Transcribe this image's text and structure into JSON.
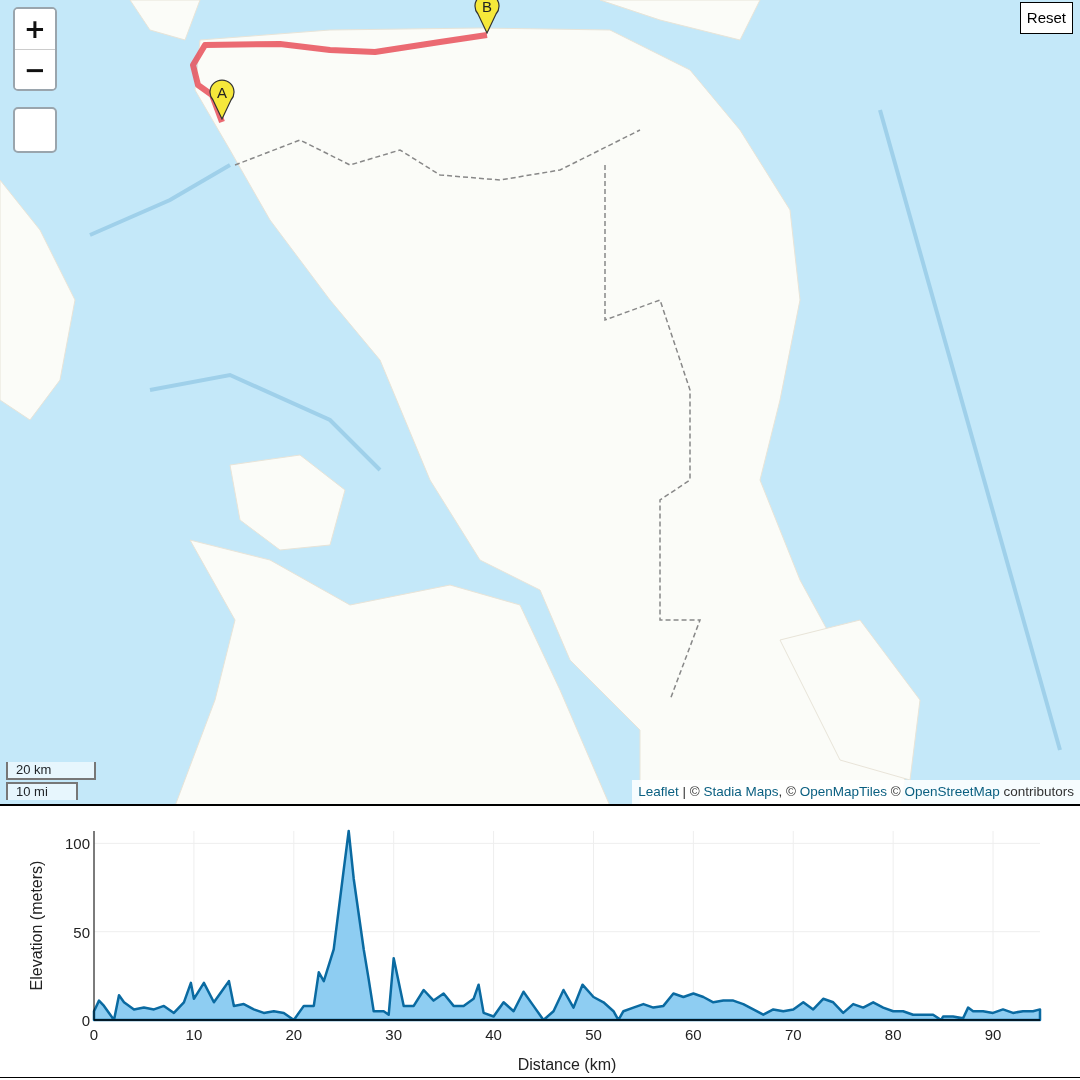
{
  "map": {
    "zoom_buttons": [
      "+",
      "−"
    ],
    "reset_button": "Reset",
    "markers": [
      {
        "label": "A"
      },
      {
        "label": "B"
      }
    ],
    "scale": [
      "20 km",
      "10 mi"
    ],
    "attribution": [
      {
        "text": "Leaflet",
        "link": true
      },
      {
        "text": " | © ",
        "link": false
      },
      {
        "text": "Stadia Maps",
        "link": true
      },
      {
        "text": ", © ",
        "link": false
      },
      {
        "text": "OpenMapTiles",
        "link": true
      },
      {
        "text": " © ",
        "link": false
      },
      {
        "text": "OpenStreetMap",
        "link": true
      },
      {
        "text": " contributors",
        "link": false
      }
    ]
  },
  "elevation_chart": {
    "chart_data": {
      "type": "area",
      "xlabel": "Distance (km)",
      "ylabel": "Elevation (meters)",
      "x": [
        0,
        0.5,
        1,
        1.5,
        2,
        2.5,
        3,
        4,
        5,
        6,
        7,
        8,
        9,
        9.7,
        10,
        11,
        12,
        13,
        13.5,
        14,
        15,
        16,
        17,
        18,
        19,
        20,
        21,
        22,
        22.5,
        23,
        24,
        25,
        25.5,
        26,
        27,
        27.5,
        28,
        29,
        29.5,
        30,
        31,
        32,
        33,
        34,
        35,
        36,
        37,
        38,
        38.5,
        39,
        40,
        41,
        42,
        43,
        44,
        45,
        46,
        47,
        48,
        48.9,
        50,
        51,
        52,
        52.5,
        53,
        54,
        55,
        56,
        57,
        58,
        59,
        60,
        61,
        62,
        63,
        64,
        65,
        66,
        67,
        68,
        69,
        70,
        71,
        72,
        73,
        74,
        75,
        76,
        77,
        78,
        79,
        80,
        81,
        82,
        83,
        84,
        84.8,
        85,
        86,
        87,
        87.5,
        88,
        89,
        90,
        91,
        92,
        93,
        94,
        94.7
      ],
      "series": [
        {
          "color": "#0a6aa1",
          "values": [
            5,
            11,
            8,
            4,
            0,
            14,
            10,
            6,
            7,
            6,
            8,
            4,
            10,
            21,
            12,
            21,
            10,
            18,
            22,
            8,
            9,
            6,
            4,
            5,
            4,
            0,
            8,
            8,
            27,
            22,
            40,
            85,
            107,
            80,
            40,
            23,
            5,
            5,
            3,
            35,
            8,
            8,
            17,
            11,
            15,
            8,
            8,
            12,
            20,
            4,
            2,
            10,
            5,
            16,
            8,
            0,
            5,
            17,
            7,
            20,
            13,
            10,
            5,
            0,
            5,
            7,
            9,
            7,
            8,
            15,
            13,
            15,
            13,
            10,
            11,
            11,
            9,
            6,
            3,
            6,
            5,
            6,
            10,
            6,
            12,
            10,
            4,
            9,
            7,
            10,
            7,
            5,
            5,
            3,
            3,
            3,
            0,
            2,
            2,
            1,
            7,
            5,
            5,
            4,
            6,
            4,
            5,
            5,
            6
          ]
        }
      ],
      "xlim": [
        0,
        94.7
      ],
      "ylim": [
        0,
        107
      ],
      "xticks": [
        0,
        10,
        20,
        30,
        40,
        50,
        60,
        70,
        80,
        90
      ],
      "yticks": [
        0,
        50,
        100
      ],
      "grid": true
    }
  }
}
